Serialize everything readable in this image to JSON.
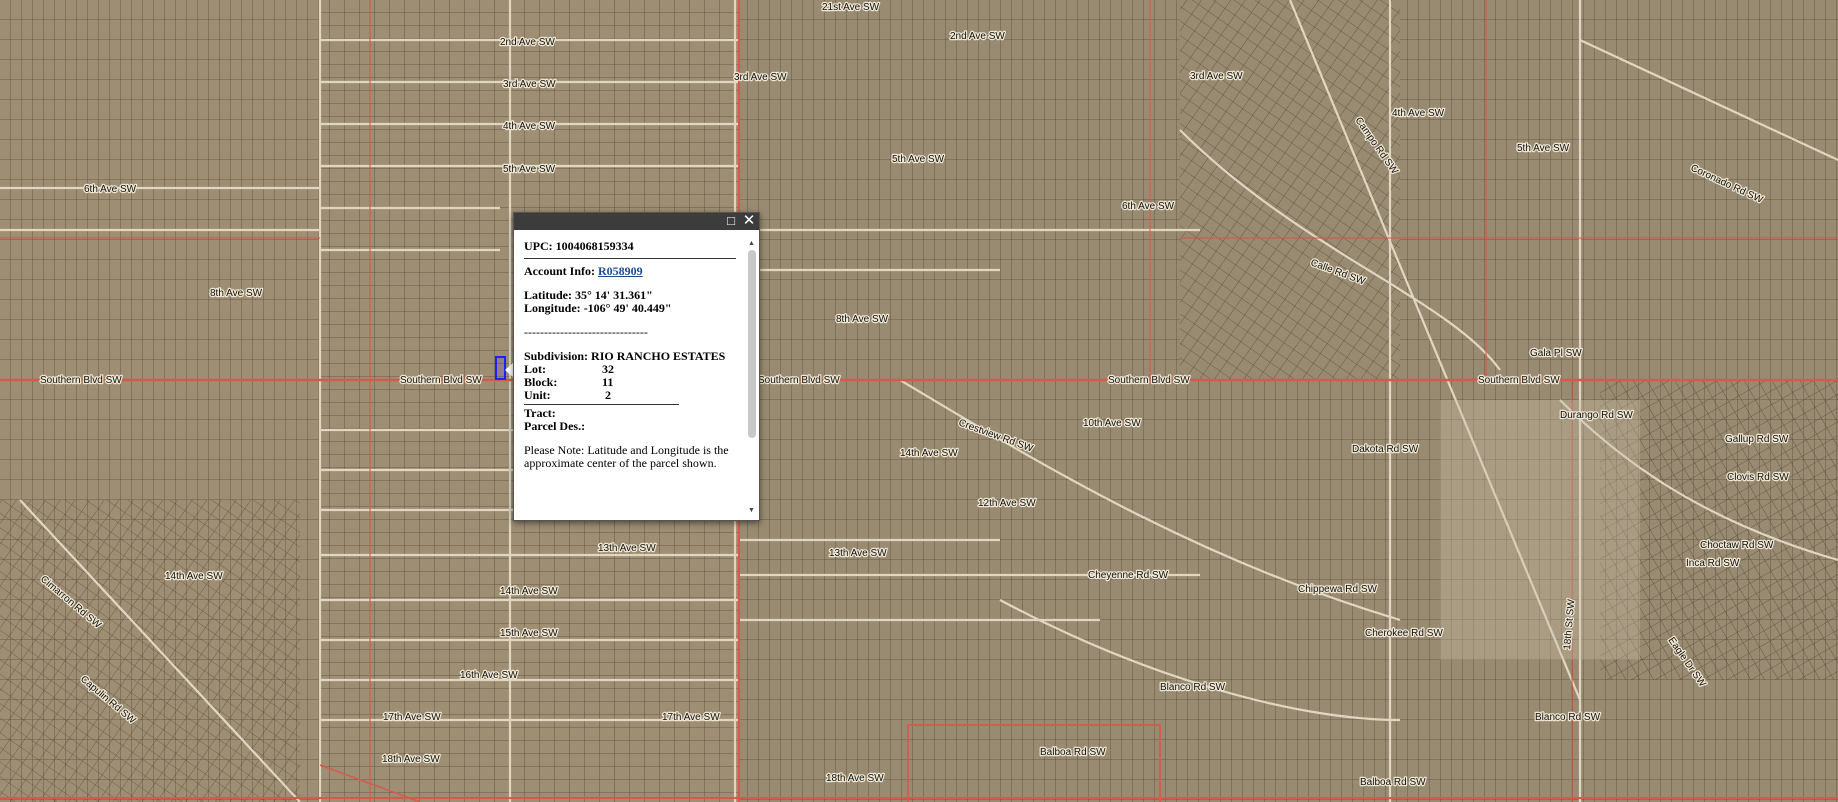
{
  "colors": {
    "road_red": "#d65a4a",
    "highlight": "#1f1fff",
    "popup_title_bg": "#3c3c3c"
  },
  "icons": {
    "maximize": "maximize-icon",
    "close": "close-icon"
  },
  "popup": {
    "upc_label": "UPC:",
    "upc_value": "1004068159334",
    "account_label": "Account Info:",
    "account_value": "R058909",
    "latitude_label": "Latitude:",
    "latitude_value": "35° 14' 31.361\"",
    "longitude_label": "Longitude:",
    "longitude_value": "-106° 49' 40.449\"",
    "dash_separator": "-------------------------------",
    "subdivision_label": "Subdivision:",
    "subdivision_value": "RIO RANCHO ESTATES",
    "lot_label": "Lot:",
    "lot_value": "32",
    "block_label": "Block:",
    "block_value": "11",
    "unit_label": "Unit:",
    "unit_value": "2",
    "tract_label": "Tract:",
    "parcel_label": "Parcel Des.:",
    "note": "Please Note: Latitude and Longitude is the approximate center of the parcel shown."
  },
  "road_labels": {
    "l1": "21st Ave SW",
    "l2": "2nd Ave SW",
    "l3": "2nd Ave SW",
    "l4": "3rd Ave SW",
    "l5": "3rd Ave SW",
    "l6": "3rd Ave SW",
    "l7": "4th Ave SW",
    "l8": "4th Ave SW",
    "l9": "5th Ave SW",
    "l10": "5th Ave SW",
    "l11": "5th Ave SW",
    "l12": "6th Ave SW",
    "l13": "6th Ave SW",
    "l14": "8th Ave SW",
    "l15": "8th Ave SW",
    "l16": "Gala Pl SW",
    "l17": "Southern Blvd SW",
    "l18": "Southern Blvd SW",
    "l19": "Southern Blvd SW",
    "l20": "Southern Blvd SW",
    "l21": "Southern Blvd SW",
    "l22": "10th Ave SW",
    "l23": "14th Ave SW",
    "l24": "12th Ave SW",
    "l25": "13th Ave SW",
    "l26": "13th Ave SW",
    "l27": "14th Ave SW",
    "l28": "14th Ave SW",
    "l29": "15th Ave SW",
    "l30": "16th Ave SW",
    "l31": "17th Ave SW",
    "l32": "17th Ave SW",
    "l33": "18th Ave SW",
    "l34": "18th Ave SW",
    "l35": "Balboa Rd SW",
    "l36": "Balboa Rd SW",
    "l37": "Blanco Rd SW",
    "l38": "Blanco Rd SW",
    "l39": "Chippewa Rd SW",
    "l40": "Cherokee Rd SW",
    "l41": "Cheyenne Rd SW",
    "l42": "Choctaw Rd SW",
    "l43": "Durango Rd SW",
    "l44": "Cimarron Rd SW",
    "l45": "Coronado Rd SW",
    "l46": "Inca Rd SW",
    "l47": "Gallup Rd SW",
    "l48": "Clovis Rd SW",
    "l49": "Capulin Rd SW",
    "l50": "Eagle Dr SW",
    "l51": "Dakota Rd SW",
    "l52": "18th St SW",
    "l53": "Crestview Rd SW",
    "l54": "Calle Rd SW",
    "l55": "Campo Rd SW"
  }
}
